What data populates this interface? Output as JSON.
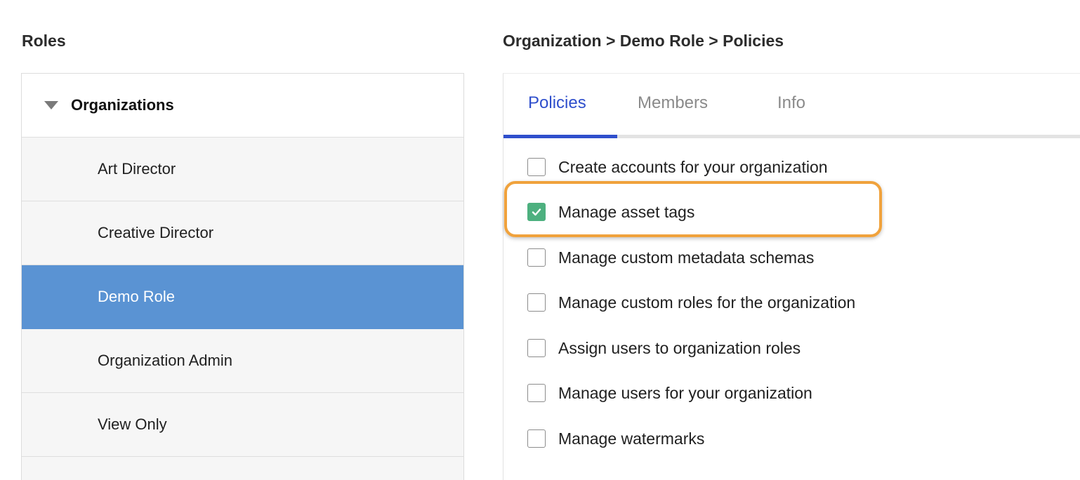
{
  "roles": {
    "heading": "Roles",
    "group_label": "Organizations",
    "items": [
      {
        "label": "Art Director"
      },
      {
        "label": "Creative Director"
      },
      {
        "label": "Demo Role",
        "selected": true
      },
      {
        "label": "Organization Admin"
      },
      {
        "label": "View Only"
      }
    ]
  },
  "breadcrumb": "Organization > Demo Role > Policies",
  "tabs": [
    {
      "label": "Policies",
      "active": true
    },
    {
      "label": "Members"
    },
    {
      "label": "Info"
    }
  ],
  "policies": [
    {
      "label": "Create accounts for your organization",
      "checked": false
    },
    {
      "label": "Manage asset tags",
      "checked": true
    },
    {
      "label": "Manage custom metadata schemas",
      "checked": false
    },
    {
      "label": "Manage custom roles for the organization",
      "checked": false
    },
    {
      "label": "Assign users to organization roles",
      "checked": false
    },
    {
      "label": "Manage users for your organization",
      "checked": false
    },
    {
      "label": "Manage watermarks",
      "checked": false
    }
  ],
  "colors": {
    "selected_row": "#5a93d3",
    "active_tab": "#2f4fcc",
    "checked_box": "#4db07f",
    "highlight": "#f0a23c"
  },
  "icons": {
    "group_toggle": "caret-down-icon",
    "checked": "checkmark-icon"
  }
}
